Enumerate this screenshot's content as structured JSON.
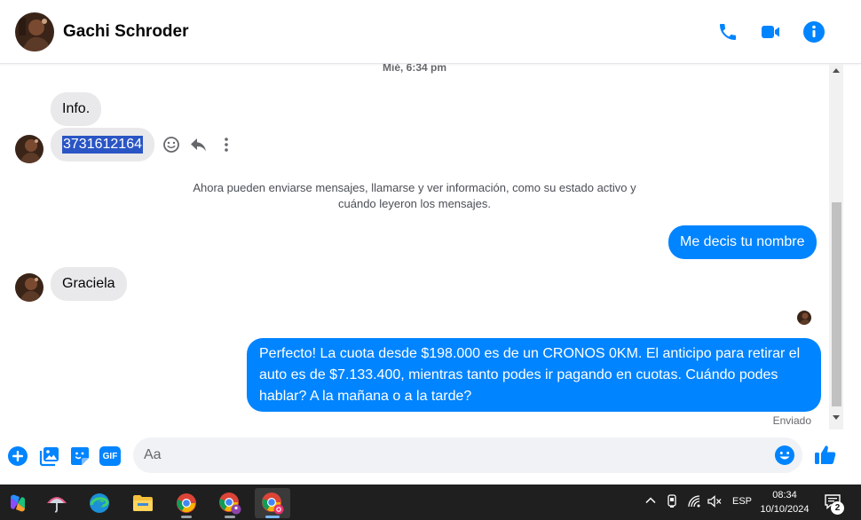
{
  "header": {
    "contact_name": "Gachi Schroder"
  },
  "conversation": {
    "timestamp": "Mié, 6:34 pm",
    "messages": [
      {
        "direction": "in",
        "text": "Info."
      },
      {
        "direction": "in",
        "text": "3731612164"
      },
      {
        "direction": "out",
        "text": "Me decis tu nombre"
      },
      {
        "direction": "in",
        "text": "Graciela"
      },
      {
        "direction": "out",
        "text": "Perfecto! La cuota desde $198.000 es de un CRONOS 0KM. El anticipo para retirar el auto es de $7.133.400, mientras tanto podes ir pagando en cuotas. Cuándo podes hablar? A la mañana o a la tarde?"
      }
    ],
    "system_notice": "Ahora pueden enviarse mensajes, llamarse y ver información, como su estado activo y cuándo leyeron los mensajes.",
    "delivery_status": "Enviado"
  },
  "composer": {
    "placeholder": "Aa",
    "gif_label": "GIF"
  },
  "taskbar": {
    "language": "ESP",
    "time": "08:34",
    "date": "10/10/2024",
    "notification_count": "2"
  },
  "colors": {
    "accent": "#0084ff",
    "incoming_bubble": "#e9e9eb",
    "taskbar_bg": "#1f1f1f"
  }
}
